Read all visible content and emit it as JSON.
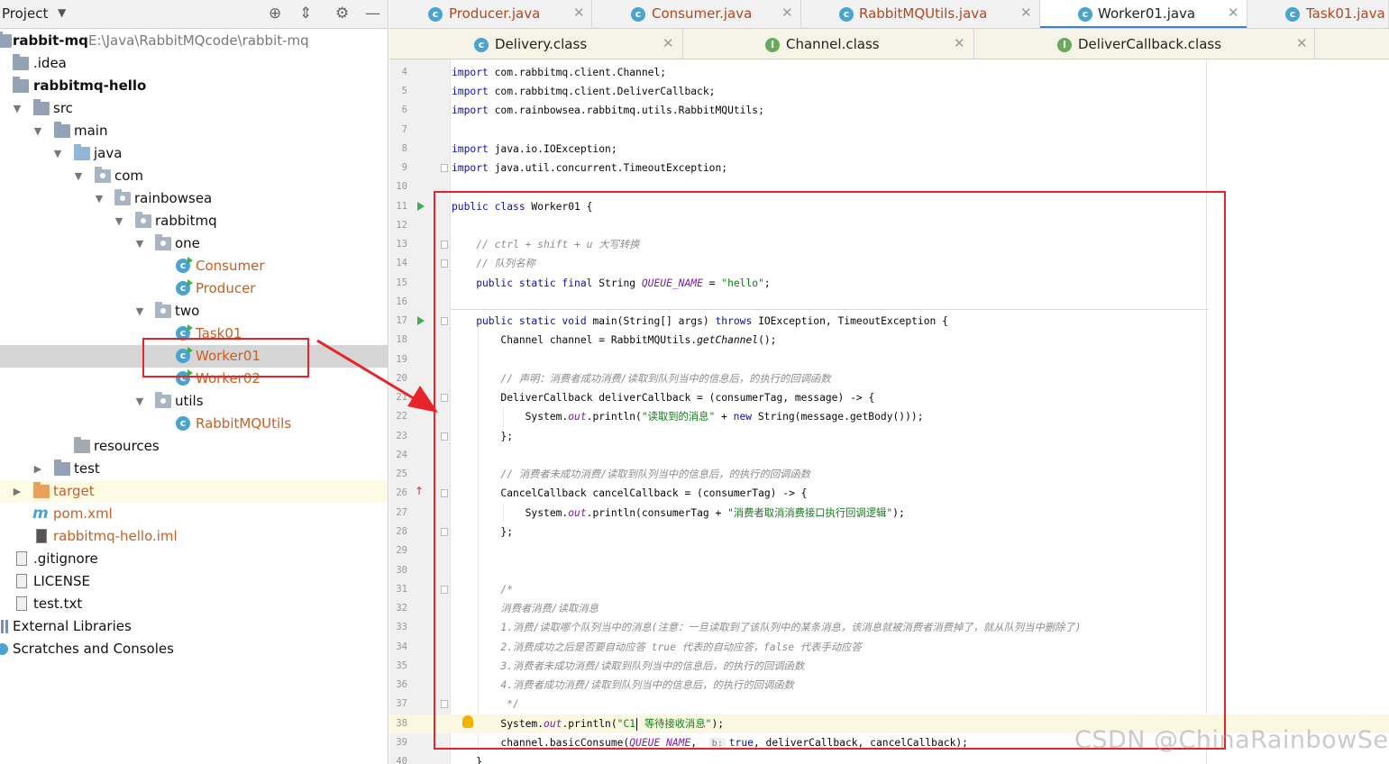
{
  "project_panel": {
    "title": "Project",
    "tree": [
      {
        "label": "rabbit-mq",
        "path": "E:\\Java\\RabbitMQcode\\rabbit-mq",
        "icon": "module-folder-icon"
      },
      {
        "label": ".idea",
        "icon": "folder-icon"
      },
      {
        "label": "rabbitmq-hello",
        "icon": "module-folder-icon"
      },
      {
        "label": "src",
        "icon": "folder-icon"
      },
      {
        "label": "main",
        "icon": "folder-icon"
      },
      {
        "label": "java",
        "icon": "source-folder-icon"
      },
      {
        "label": "com",
        "icon": "package-icon"
      },
      {
        "label": "rainbowsea",
        "icon": "package-icon"
      },
      {
        "label": "rabbitmq",
        "icon": "package-icon"
      },
      {
        "label": "one",
        "icon": "package-icon"
      },
      {
        "label": "Consumer",
        "icon": "class-icon"
      },
      {
        "label": "Producer",
        "icon": "class-icon"
      },
      {
        "label": "two",
        "icon": "package-icon"
      },
      {
        "label": "Task01",
        "icon": "class-icon"
      },
      {
        "label": "Worker01",
        "icon": "class-icon"
      },
      {
        "label": "Worker02",
        "icon": "class-icon"
      },
      {
        "label": "utils",
        "icon": "package-icon"
      },
      {
        "label": "RabbitMQUtils",
        "icon": "class-icon"
      },
      {
        "label": "resources",
        "icon": "resources-folder-icon"
      },
      {
        "label": "test",
        "icon": "folder-icon"
      },
      {
        "label": "target",
        "icon": "excluded-folder-icon"
      },
      {
        "label": "pom.xml",
        "icon": "maven-icon"
      },
      {
        "label": "rabbitmq-hello.iml",
        "icon": "iml-file-icon"
      },
      {
        "label": ".gitignore",
        "icon": "file-icon"
      },
      {
        "label": "LICENSE",
        "icon": "file-icon"
      },
      {
        "label": "test.txt",
        "icon": "text-file-icon"
      },
      {
        "label": "External Libraries",
        "icon": "library-icon"
      },
      {
        "label": "Scratches and Consoles",
        "icon": "scratches-icon"
      }
    ]
  },
  "tabs_row1": [
    {
      "label": "Producer.java"
    },
    {
      "label": "Consumer.java"
    },
    {
      "label": "RabbitMQUtils.java"
    },
    {
      "label": "Worker01.java",
      "active": true
    },
    {
      "label": "Task01.java"
    }
  ],
  "tabs_row2": [
    {
      "label": "Delivery.class"
    },
    {
      "label": "Channel.class"
    },
    {
      "label": "DeliverCallback.class"
    }
  ],
  "editor": {
    "line_numbers": [
      "4",
      "5",
      "6",
      "7",
      "8",
      "9",
      "10",
      "11",
      "12",
      "13",
      "14",
      "15",
      "16",
      "17",
      "18",
      "19",
      "20",
      "21",
      "22",
      "23",
      "24",
      "25",
      "26",
      "27",
      "28",
      "29",
      "30",
      "31",
      "32",
      "33",
      "34",
      "35",
      "36",
      "37",
      "38",
      "39",
      "40"
    ],
    "lines": {
      "l4_kw": "import",
      "l4_rest": " com.rabbitmq.client.Channel;",
      "l5_kw": "import",
      "l5_rest": " com.rabbitmq.client.DeliverCallback;",
      "l6_kw": "import",
      "l6_rest": " com.rainbowsea.rabbitmq.utils.RabbitMQUtils;",
      "l8_kw": "import",
      "l8_rest": " java.io.IOException;",
      "l9_kw": "import",
      "l9_rest": " java.util.concurrent.TimeoutException;",
      "l11_kw": "public class",
      "l11_rest": " Worker01 {",
      "l13": "    // ctrl + shift + u 大写转换",
      "l14": "    // 队列名称",
      "l15_kw": "    public static final",
      "l15_type": " String ",
      "l15_field": "QUEUE_NAME",
      "l15_eq": " = ",
      "l15_str": "\"hello\"",
      "l15_end": ";",
      "l17_kw": "    public static void",
      "l17_mid": " main(String[] args) ",
      "l17_kw2": "throws",
      "l17_end": " IOException, TimeoutException {",
      "l18_a": "        Channel channel = RabbitMQUtils.",
      "l18_m": "getChannel",
      "l18_b": "();",
      "l20": "        // 声明：消费者成功消费/读取到队列当中的信息后，的执行的回调函数",
      "l21": "        DeliverCallback deliverCallback = (consumerTag, message) -> {",
      "l22_a": "            System.",
      "l22_out": "out",
      "l22_b": ".println(",
      "l22_str": "\"读取到的消息\"",
      "l22_c": " + ",
      "l22_kw": "new",
      "l22_d": " String(message.getBody()));",
      "l23": "        };",
      "l25": "        // 消费者未成功消费/读取到队列当中的信息后，的执行的回调函数",
      "l26": "        CancelCallback cancelCallback = (consumerTag) -> {",
      "l27_a": "            System.",
      "l27_out": "out",
      "l27_b": ".println(consumerTag + ",
      "l27_str": "\"消费者取消消费接口执行回调逻辑\"",
      "l27_c": ");",
      "l28": "        };",
      "l31": "        /*",
      "l32": "        消费者消费/读取消息",
      "l33": "        1.消费/读取哪个队列当中的消息(注意：一旦读取到了该队列中的某条消息，该消息就被消费者消费掉了，就从队列当中删除了)",
      "l34": "        2.消费成功之后是否要自动应答 true 代表的自动应答，false 代表手动应答",
      "l35": "        3.消费者未成功消费/读取到队列当中的信息后，的执行的回调函数",
      "l36": "        4.消费者成功消费/读取到队列当中的信息后，的执行的回调函数",
      "l37": "         */",
      "l38_a": "        System.",
      "l38_out": "out",
      "l38_b": ".println(",
      "l38_str1": "\"C1",
      "l38_str2": " 等待接收消息\"",
      "l38_c": ");",
      "l39_a": "        channel.basicConsume(",
      "l39_f": "QUEUE_NAME",
      "l39_b": ",  ",
      "l39_hint": "b:",
      "l39_kw": "true",
      "l39_c": ", deliverCallback, cancelCallback);",
      "l40": "    }"
    }
  },
  "watermark": "CSDN @ChinaRainbowSea",
  "colors": {
    "annotation_red": "#e8242a",
    "keyword": "#0b0fa6",
    "string": "#0c7f13",
    "comment": "#8c8c8c"
  }
}
